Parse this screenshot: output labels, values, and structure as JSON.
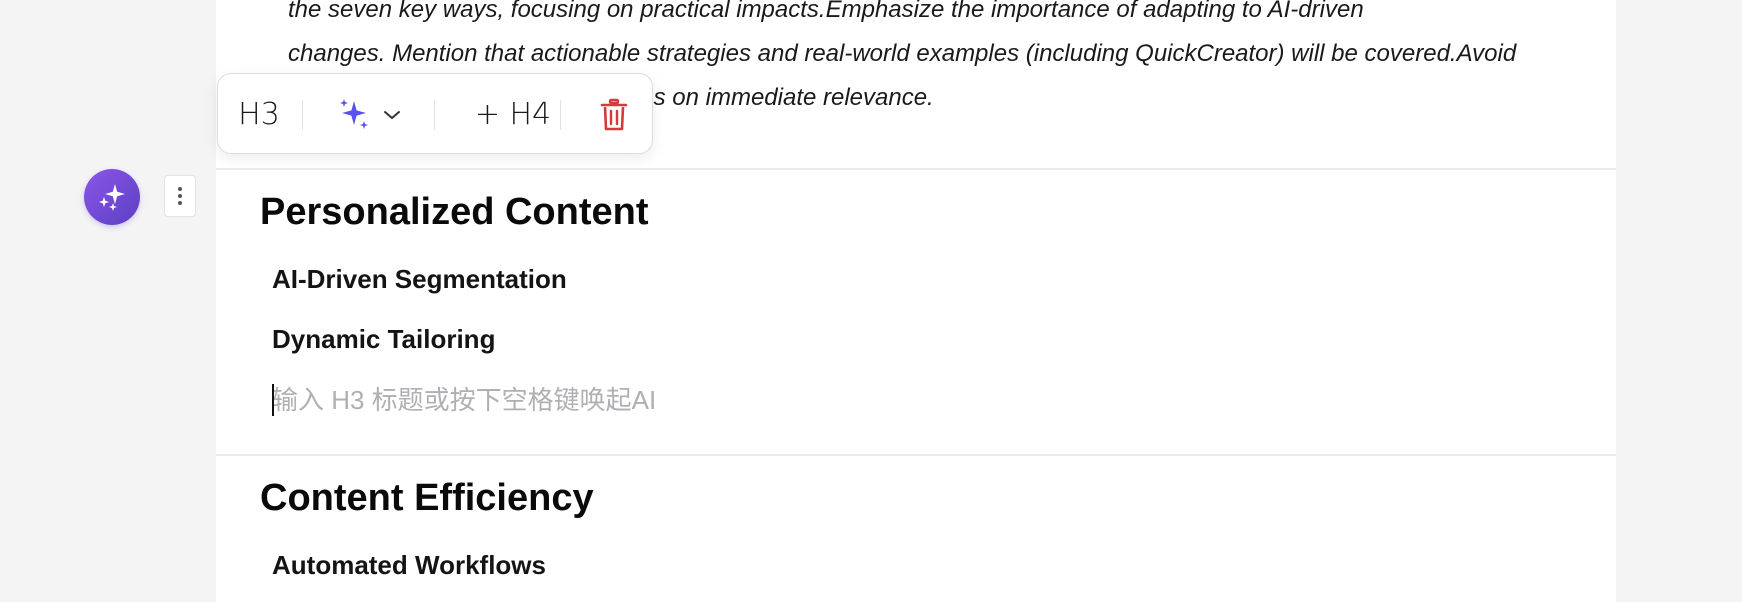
{
  "intro_paragraph": {
    "lines": [
      "the seven key ways, focusing on practical impacts.Emphasize the importance of adapting to AI-driven",
      "changes. Mention that actionable strategies and real-world examples (including QuickCreator) will be covered.Avoid",
      "technical jargon and keep the focus on immediate relevance."
    ]
  },
  "toolbar": {
    "heading_level_label": "H3",
    "ai_menu_icon": "sparkles-icon",
    "ai_dropdown_icon": "chevron-down-icon",
    "add_subheading_label": "+ H4",
    "delete_icon": "trash-icon",
    "colors": {
      "ai_accent": "#5b4ff0",
      "delete": "#d43a3a"
    }
  },
  "gutter": {
    "ai_button_icon": "sparkles-icon",
    "drag_handle_icon": "vertical-dots-icon",
    "ai_button_color": "#6a48d6"
  },
  "sections": [
    {
      "title": "Personalized Content",
      "subheadings": [
        "AI-Driven Segmentation",
        "Dynamic Tailoring"
      ],
      "new_subheading_placeholder": "输入 H3 标题或按下空格键唤起AI"
    },
    {
      "title": "Content Efficiency",
      "subheadings": [
        "Automated Workflows"
      ]
    }
  ]
}
